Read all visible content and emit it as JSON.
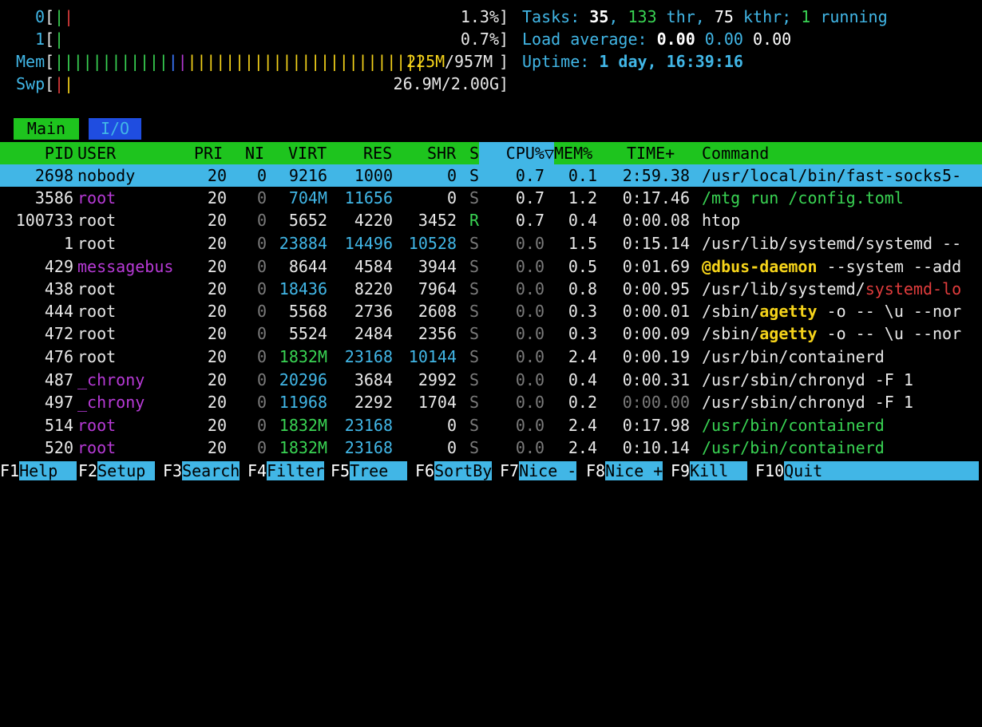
{
  "meters": {
    "cpu0": {
      "label": "0",
      "open": "[",
      "close": "]",
      "value": "1.3%"
    },
    "cpu1": {
      "label": "1",
      "open": "[",
      "close": "]",
      "value": "0.7%"
    },
    "mem": {
      "label": "Mem",
      "open": "[",
      "close": "]",
      "used": "225M",
      "sep": "/",
      "total": "957M"
    },
    "swp": {
      "label": "Swp",
      "open": "[",
      "close": "]",
      "value": "26.9M/2.00G"
    }
  },
  "tasks": {
    "label": "Tasks: ",
    "tasks": "35",
    "comma1": ", ",
    "thr": "133",
    "thr_label": " thr, ",
    "kthr": "75",
    "kthr_label": " kthr; ",
    "running": "1",
    "running_label": " running"
  },
  "load": {
    "label": "Load average: ",
    "l1": "0.00",
    "l5": "0.00",
    "l15": "0.00"
  },
  "uptime": {
    "label": "Uptime: ",
    "value": "1 day, 16:39:16"
  },
  "tabs": {
    "main": "Main",
    "io": "I/O"
  },
  "columns": {
    "pid": "PID",
    "user": "USER",
    "pri": "PRI",
    "ni": "NI",
    "virt": "VIRT",
    "res": "RES",
    "shr": "SHR",
    "s": "S",
    "cpu": "CPU%▽",
    "mem": "MEM%",
    "time": "TIME+",
    "command": "Command"
  },
  "processes": [
    {
      "pid": "2698",
      "user": "nobody",
      "pri": "20",
      "ni": "0",
      "virt": "9216",
      "res": "1000",
      "shr": "0",
      "s": "S",
      "cpu": "0.7",
      "mem": "0.1",
      "time": "2:59.38",
      "cmd": "/usr/local/bin/fast-socks5-"
    },
    {
      "pid": "3586",
      "user": "root",
      "pri": "20",
      "ni": "0",
      "virt": "704M",
      "res": "11656",
      "shr": "0",
      "s": "S",
      "cpu": "0.7",
      "mem": "1.2",
      "time": "0:17.46",
      "cmd": "/mtg run /config.toml"
    },
    {
      "pid": "100733",
      "user": "root",
      "pri": "20",
      "ni": "0",
      "virt": "5652",
      "res": "4220",
      "shr": "3452",
      "s": "R",
      "cpu": "0.7",
      "mem": "0.4",
      "time": "0:00.08",
      "cmd": "htop"
    },
    {
      "pid": "1",
      "user": "root",
      "pri": "20",
      "ni": "0",
      "virt": "23884",
      "res": "14496",
      "shr": "10528",
      "s": "S",
      "cpu": "0.0",
      "mem": "1.5",
      "time": "0:15.14",
      "cmd": "/usr/lib/systemd/systemd --"
    },
    {
      "pid": "429",
      "user": "messagebus",
      "pri": "20",
      "ni": "0",
      "virt": "8644",
      "res": "4584",
      "shr": "3944",
      "s": "S",
      "cpu": "0.0",
      "mem": "0.5",
      "time": "0:01.69",
      "cmd_a": "@dbus-daemon",
      "cmd_b": " --system --add"
    },
    {
      "pid": "438",
      "user": "root",
      "pri": "20",
      "ni": "0",
      "virt": "18436",
      "res": "8220",
      "shr": "7964",
      "s": "S",
      "cpu": "0.0",
      "mem": "0.8",
      "time": "0:00.95",
      "cmd_a": "/usr/lib/systemd/",
      "cmd_b": "systemd-lo"
    },
    {
      "pid": "444",
      "user": "root",
      "pri": "20",
      "ni": "0",
      "virt": "5568",
      "res": "2736",
      "shr": "2608",
      "s": "S",
      "cpu": "0.0",
      "mem": "0.3",
      "time": "0:00.01",
      "cmd_a": "/sbin/",
      "cmd_b": "agetty",
      "cmd_c": " -o -- \\u --nor"
    },
    {
      "pid": "472",
      "user": "root",
      "pri": "20",
      "ni": "0",
      "virt": "5524",
      "res": "2484",
      "shr": "2356",
      "s": "S",
      "cpu": "0.0",
      "mem": "0.3",
      "time": "0:00.09",
      "cmd_a": "/sbin/",
      "cmd_b": "agetty",
      "cmd_c": " -o -- \\u --nor"
    },
    {
      "pid": "476",
      "user": "root",
      "pri": "20",
      "ni": "0",
      "virt": "1832M",
      "res": "23168",
      "shr": "10144",
      "s": "S",
      "cpu": "0.0",
      "mem": "2.4",
      "time": "0:00.19",
      "cmd": "/usr/bin/containerd"
    },
    {
      "pid": "487",
      "user": "_chrony",
      "pri": "20",
      "ni": "0",
      "virt": "20296",
      "res": "3684",
      "shr": "2992",
      "s": "S",
      "cpu": "0.0",
      "mem": "0.4",
      "time": "0:00.31",
      "cmd": "/usr/sbin/chronyd -F 1"
    },
    {
      "pid": "497",
      "user": "_chrony",
      "pri": "20",
      "ni": "0",
      "virt": "11968",
      "res": "2292",
      "shr": "1704",
      "s": "S",
      "cpu": "0.0",
      "mem": "0.2",
      "time": "0:00.00",
      "cmd": "/usr/sbin/chronyd -F 1"
    },
    {
      "pid": "514",
      "user": "root",
      "pri": "20",
      "ni": "0",
      "virt": "1832M",
      "res": "23168",
      "shr": "0",
      "s": "S",
      "cpu": "0.0",
      "mem": "2.4",
      "time": "0:17.98",
      "cmd": "/usr/bin/containerd"
    },
    {
      "pid": "520",
      "user": "root",
      "pri": "20",
      "ni": "0",
      "virt": "1832M",
      "res": "23168",
      "shr": "0",
      "s": "S",
      "cpu": "0.0",
      "mem": "2.4",
      "time": "0:10.14",
      "cmd": "/usr/bin/containerd"
    }
  ],
  "footer": [
    {
      "key": "F1",
      "label": "Help  "
    },
    {
      "key": "F2",
      "label": "Setup "
    },
    {
      "key": "F3",
      "label": "Search"
    },
    {
      "key": "F4",
      "label": "Filter"
    },
    {
      "key": "F5",
      "label": "Tree  "
    },
    {
      "key": "F6",
      "label": "SortBy"
    },
    {
      "key": "F7",
      "label": "Nice -"
    },
    {
      "key": "F8",
      "label": "Nice +"
    },
    {
      "key": "F9",
      "label": "Kill  "
    },
    {
      "key": "F10",
      "label": "Quit"
    }
  ],
  "colors": {
    "header_bg": "#1ec41e",
    "selection": "#41b6e6",
    "cyan": "#41b6e6",
    "green": "#39d353",
    "magenta": "#b73ad6",
    "yellow": "#f5d31a"
  }
}
